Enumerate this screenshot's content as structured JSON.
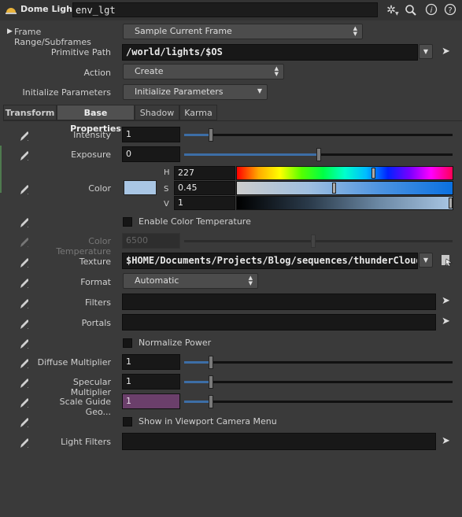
{
  "header": {
    "node_type": "Dome Light",
    "node_name": "env_lgt",
    "icons": [
      "gear-icon",
      "search-icon",
      "info-icon",
      "help-icon"
    ]
  },
  "top": {
    "frame_range_label": "Frame Range/Subframes",
    "frame_range_value": "Sample Current Frame",
    "primitive_path_label": "Primitive Path",
    "primitive_path_value": "/world/lights/$OS",
    "action_label": "Action",
    "action_value": "Create",
    "init_params_label": "Initialize Parameters",
    "init_params_value": "Initialize Parameters"
  },
  "tabs": [
    {
      "label": "Transform"
    },
    {
      "label": "Base Properties"
    },
    {
      "label": "Shadow"
    },
    {
      "label": "Karma"
    }
  ],
  "params": {
    "intensity_label": "Intensity",
    "intensity_value": "1",
    "intensity_slider": 0.1,
    "exposure_label": "Exposure",
    "exposure_value": "0",
    "exposure_slider": 0.5,
    "color_label": "Color",
    "color_swatch": "#a9c6e4",
    "h_label": "H",
    "h_value": "227",
    "h_slider": 0.63,
    "s_label": "S",
    "s_value": "0.45",
    "s_slider": 0.45,
    "v_label": "V",
    "v_value": "1",
    "v_slider": 1.0,
    "enable_color_temp_label": "Enable Color Temperature",
    "color_temp_label": "Color Temperature",
    "color_temp_value": "6500",
    "color_temp_slider": 0.48,
    "texture_label": "Texture",
    "texture_value": "$HOME/Documents/Projects/Blog/sequences/thunderCloudH",
    "format_label": "Format",
    "format_value": "Automatic",
    "filters_label": "Filters",
    "filters_value": "",
    "portals_label": "Portals",
    "portals_value": "",
    "normalize_power_label": "Normalize Power",
    "diffuse_label": "Diffuse Multiplier",
    "diffuse_value": "1",
    "diffuse_slider": 0.1,
    "specular_label": "Specular Multiplier",
    "specular_value": "1",
    "specular_slider": 0.1,
    "scale_guide_label": "Scale Guide Geo...",
    "scale_guide_value": "1",
    "scale_guide_slider": 0.1,
    "show_viewport_label": "Show in Viewport Camera Menu",
    "light_filters_label": "Light Filters",
    "light_filters_value": ""
  },
  "colors": {
    "slider_fill": "#3d6ea6",
    "scale_guide_bg": "#6b3f6b",
    "swatch": "#a9c6e4"
  }
}
